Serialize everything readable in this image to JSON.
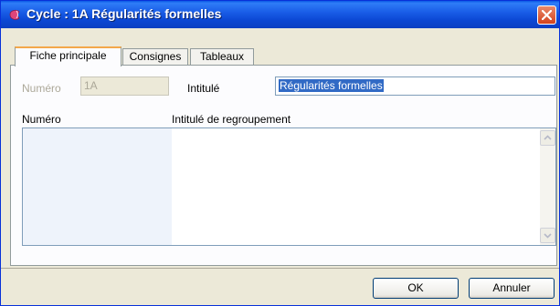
{
  "window": {
    "title": "Cycle : 1A Régularités formelles",
    "icon": "app-icon",
    "close_icon": "close-icon"
  },
  "tabs": [
    {
      "label": "Fiche principale",
      "active": true
    },
    {
      "label": "Consignes",
      "active": false
    },
    {
      "label": "Tableaux",
      "active": false
    }
  ],
  "form": {
    "numero_label": "Numéro",
    "numero_value": "1A",
    "intitule_label": "Intitulé",
    "intitule_value": "Régularités formelles"
  },
  "grid": {
    "columns": [
      "Numéro",
      "Intitulé de regroupement"
    ],
    "rows": []
  },
  "buttons": {
    "ok": "OK",
    "cancel": "Annuler"
  },
  "colors": {
    "titlebar": "#0b4fd8",
    "selection": "#316ac5",
    "tab_accent": "#f3a84a"
  }
}
